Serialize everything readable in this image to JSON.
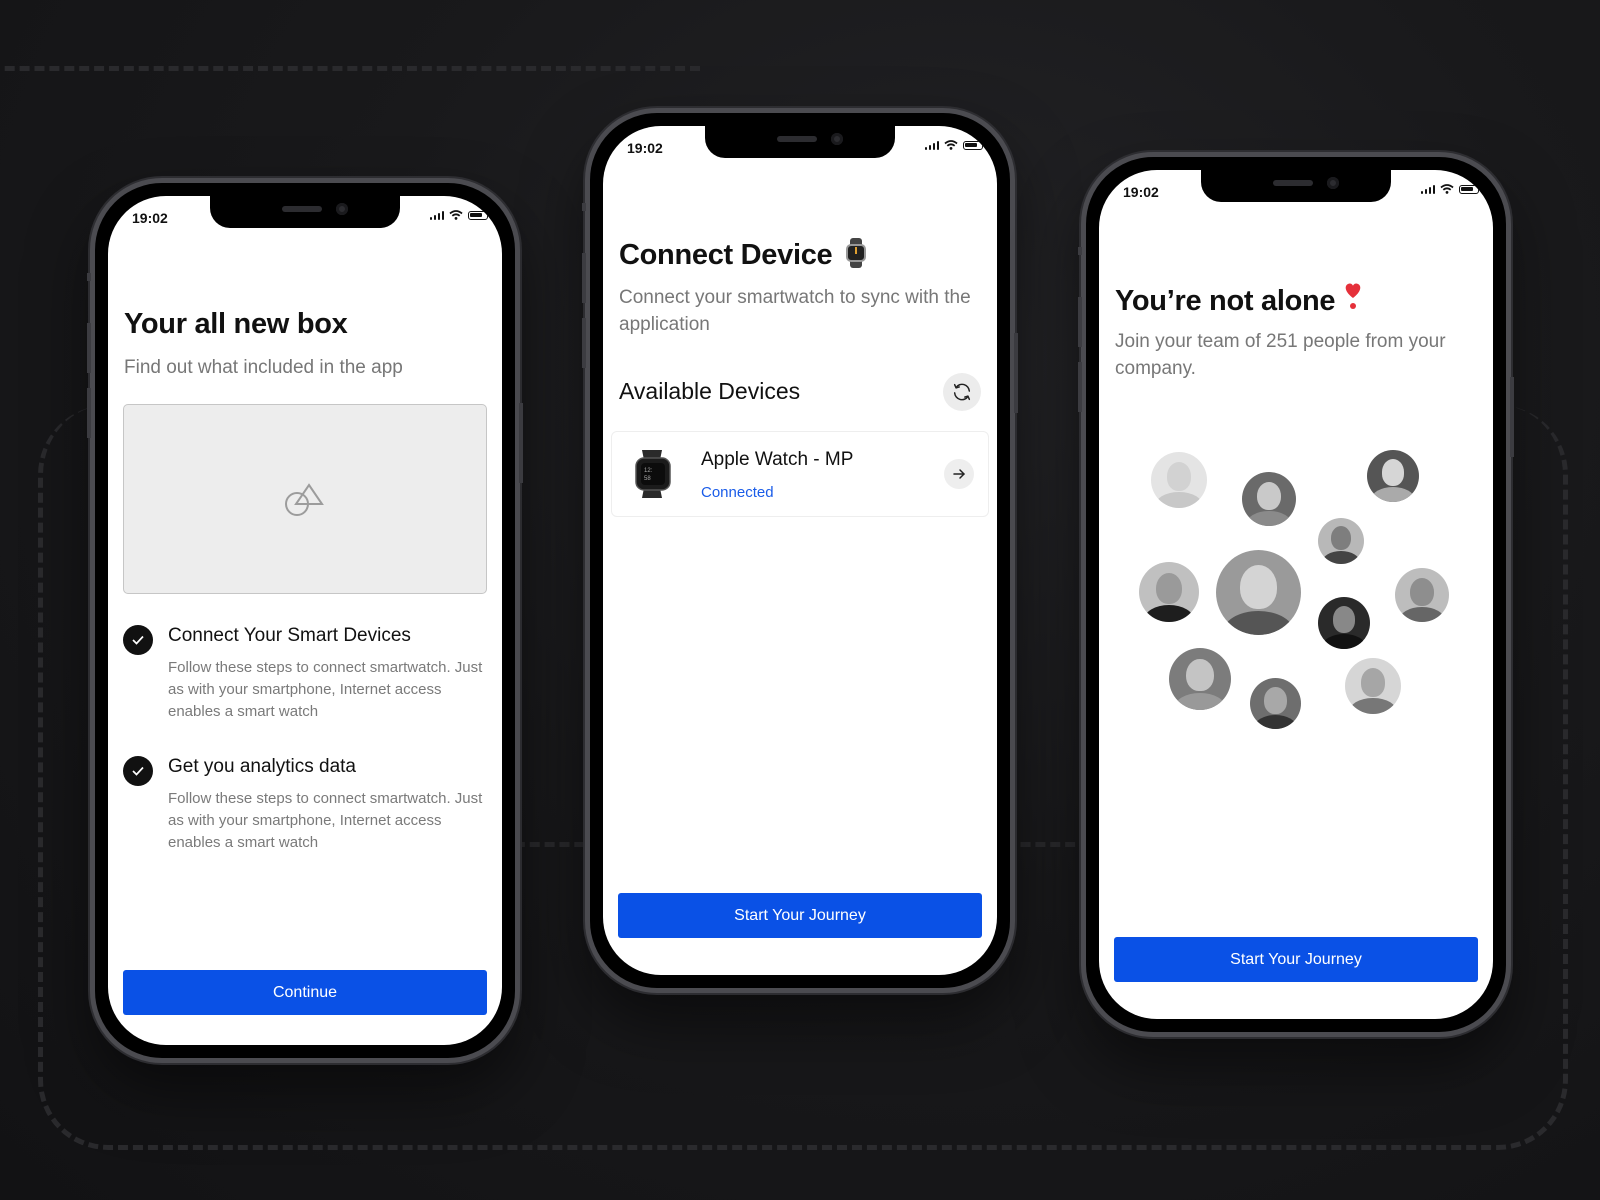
{
  "colors": {
    "accent": "#0a51e6",
    "connected": "#1a5ce8",
    "text_primary": "#111111",
    "text_secondary": "#777777"
  },
  "phones": [
    {
      "status_time": "19:02",
      "title": "Your all new box",
      "subtitle": "Find out what included in the app",
      "image_placeholder_icon": "shapes-icon",
      "features": [
        {
          "icon": "check-circle-icon",
          "title": "Connect Your Smart Devices",
          "description": "Follow these steps to connect smartwatch. Just as with your smartphone, Internet access enables a smart watch"
        },
        {
          "icon": "check-circle-icon",
          "title": "Get you analytics data",
          "description": "Follow these steps to connect smartwatch. Just as with your smartphone, Internet access enables a smart watch"
        }
      ],
      "button_label": "Continue"
    },
    {
      "status_time": "19:02",
      "title": "Connect Device",
      "title_emoji": "⌚",
      "subtitle": "Connect your smartwatch to sync with the application",
      "section_title": "Available Devices",
      "refresh_icon": "refresh-icon",
      "devices": [
        {
          "name": "Apple Watch - MP",
          "status": "Connected",
          "icon": "smartwatch-image",
          "action_icon": "arrow-right-icon"
        }
      ],
      "button_label": "Start Your Journey"
    },
    {
      "status_time": "19:02",
      "title": "You’re not alone",
      "title_emoji": "❣️",
      "subtitle": "Join your team of 251 people from your company.",
      "team_count": 251,
      "avatars_count": 11,
      "button_label": "Start Your Journey"
    }
  ]
}
